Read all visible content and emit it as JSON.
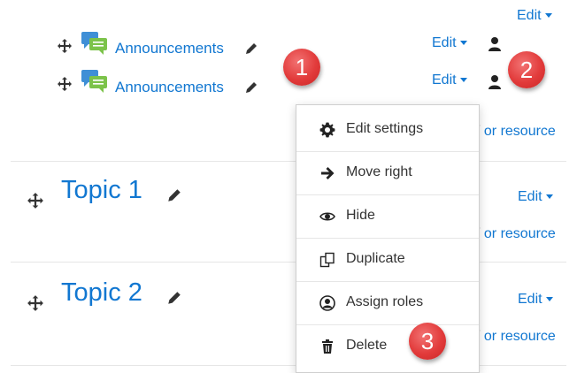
{
  "top_edit": "Edit",
  "activities": [
    {
      "label": "Announcements",
      "edit": "Edit"
    },
    {
      "label": "Announcements",
      "edit": "Edit"
    }
  ],
  "sections": [
    {
      "title": "Topic 1",
      "edit": "Edit"
    },
    {
      "title": "Topic 2",
      "edit": "Edit"
    }
  ],
  "add_activity_fragment": "or resource",
  "menu": {
    "items": [
      {
        "label": "Edit settings",
        "icon": "gear-icon"
      },
      {
        "label": "Move right",
        "icon": "arrow-right-icon"
      },
      {
        "label": "Hide",
        "icon": "eye-icon"
      },
      {
        "label": "Duplicate",
        "icon": "duplicate-icon"
      },
      {
        "label": "Assign roles",
        "icon": "user-circle-icon"
      },
      {
        "label": "Delete",
        "icon": "trash-icon"
      }
    ]
  },
  "badges": [
    "1",
    "2",
    "3"
  ],
  "colors": {
    "link": "#1177d1",
    "badge": "#e23b3b",
    "forum_icon_blue": "#3f8fd6",
    "forum_icon_green": "#7cc34a"
  }
}
